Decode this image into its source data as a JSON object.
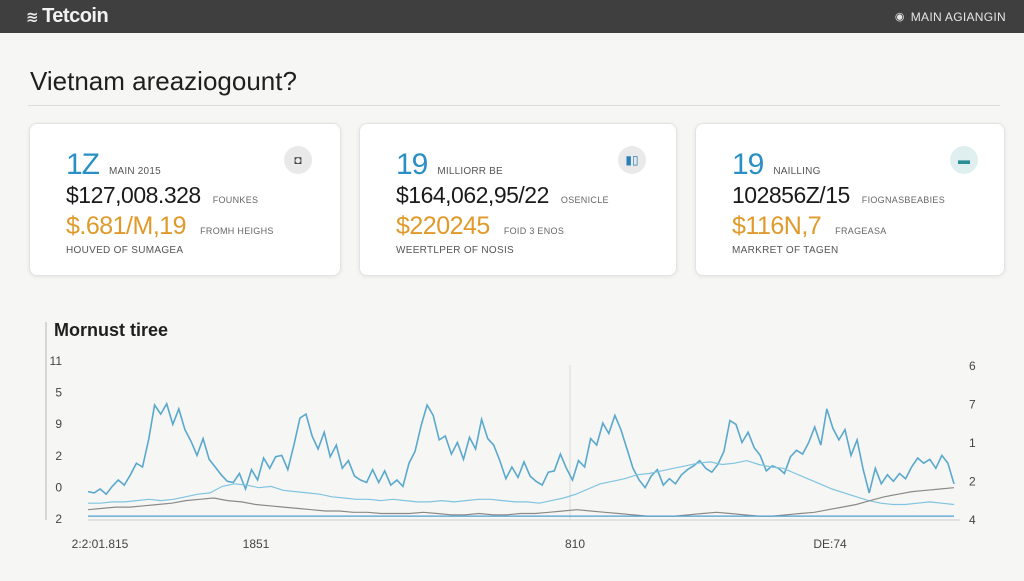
{
  "header": {
    "brand": "Tetcoin",
    "brand_icon": "stacked-coin-icon",
    "user_label": "MAIN AGIANGIN",
    "user_icon": "user-icon"
  },
  "page": {
    "title": "Vietnam areaziogount?"
  },
  "cards": [
    {
      "big_number": "1Z",
      "big_label": "MAIN 2015",
      "amount": "$127,008.328",
      "amount_label": "FOUNKES",
      "highlight": "$.681/M,19",
      "highlight_label": "FROMH HEIGHS",
      "footer": "HOUVED OF SUMAGEA",
      "icon": "wallet-icon"
    },
    {
      "big_number": "19",
      "big_label": "MILLIORR BE",
      "amount": "$164,062,95/22",
      "amount_label": "OSENICLE",
      "highlight": "$220245",
      "highlight_label": "FOID 3 ENOS",
      "footer": "WEERTLPER OF NOSIS",
      "icon": "bar-chart-icon"
    },
    {
      "big_number": "19",
      "big_label": "NAILLING",
      "amount": "102856Z/15",
      "amount_label": "FIOGNASBEABIES",
      "highlight": "$116N,7",
      "highlight_label": "FRAGEASA",
      "footer": "MARKRET OF TAGEN",
      "icon": "card-icon"
    }
  ],
  "chart_data": {
    "type": "line",
    "title": "Mornust tiree",
    "x_tick_labels": [
      "2:2:01.815",
      "1851",
      "810",
      "DE:74"
    ],
    "y_left_ticks": [
      "11",
      "5",
      "9",
      "2",
      "0",
      "2"
    ],
    "y_right_ticks": [
      "6",
      "7",
      "1",
      "2",
      "4"
    ],
    "ylim": [
      0,
      12
    ],
    "series": [
      {
        "color": "#5aa8cc",
        "values": [
          2.2,
          2.1,
          2.4,
          2.0,
          2.6,
          3.1,
          2.7,
          3.5,
          4.4,
          4.1,
          6.2,
          8.9,
          8.2,
          9.0,
          7.4,
          8.6,
          7.0,
          6.1,
          5.0,
          6.3,
          4.7,
          4.1,
          3.5,
          3.0,
          2.9,
          3.6,
          2.4,
          3.9,
          3.1,
          4.8,
          4.0,
          4.9,
          5.0,
          3.9,
          5.8,
          7.9,
          8.2,
          6.5,
          5.5,
          6.8,
          4.9,
          5.8,
          4.0,
          4.6,
          3.4,
          3.1,
          2.9,
          3.9,
          2.9,
          3.8,
          2.7,
          3.1,
          2.6,
          4.4,
          5.3,
          7.3,
          8.9,
          8.1,
          6.2,
          6.5,
          5.1,
          6.0,
          4.7,
          6.4,
          5.5,
          7.8,
          6.3,
          5.8,
          4.6,
          3.2,
          4.1,
          3.3,
          4.5,
          3.4,
          3.0,
          2.7,
          3.7,
          3.8,
          5.1,
          4.0,
          3.1,
          4.6,
          4.1,
          6.3,
          5.8,
          7.5,
          6.7,
          8.1,
          7.0,
          5.5,
          4.0,
          3.1,
          2.5,
          3.4,
          3.9,
          2.7,
          3.2,
          2.8,
          3.5,
          3.9,
          4.2,
          4.6,
          4.0,
          3.7,
          4.3,
          5.3,
          7.7,
          7.4,
          6.0,
          6.8,
          5.6,
          5.0,
          3.8,
          4.2,
          4.0,
          3.6,
          4.9,
          5.4,
          5.1,
          6.0,
          7.2,
          5.8,
          8.6,
          7.1,
          6.2,
          7.0,
          5.0,
          6.2,
          3.9,
          2.1,
          4.0,
          2.8,
          3.5,
          3.0,
          3.6,
          3.2,
          4.1,
          4.8,
          4.4,
          4.7,
          4.0,
          5.0,
          4.4,
          2.8
        ]
      },
      {
        "color": "#7fc4e0",
        "values": [
          1.3,
          1.3,
          1.4,
          1.4,
          1.5,
          1.6,
          1.5,
          1.6,
          1.8,
          2.0,
          2.1,
          2.6,
          2.8,
          2.7,
          2.5,
          2.6,
          2.3,
          2.2,
          2.1,
          2.0,
          1.8,
          1.7,
          1.6,
          1.6,
          1.5,
          1.6,
          1.5,
          1.4,
          1.4,
          1.5,
          1.4,
          1.5,
          1.6,
          1.6,
          1.5,
          1.4,
          1.4,
          1.3,
          1.5,
          1.7,
          2.0,
          2.4,
          2.8,
          3.0,
          3.2,
          3.5,
          3.6,
          3.8,
          4.0,
          4.2,
          4.4,
          4.5,
          4.3,
          4.4,
          4.6,
          4.3,
          4.1,
          4.0,
          3.6,
          3.2,
          2.8,
          2.4,
          2.1,
          1.8,
          1.5,
          1.3,
          1.2,
          1.2,
          1.3,
          1.4,
          1.3,
          1.2
        ]
      },
      {
        "color": "#8a8a8a",
        "values": [
          0.8,
          0.9,
          1.0,
          1.0,
          1.1,
          1.2,
          1.3,
          1.5,
          1.6,
          1.7,
          1.5,
          1.4,
          1.2,
          1.1,
          1.0,
          0.9,
          0.8,
          0.7,
          0.7,
          0.6,
          0.6,
          0.5,
          0.5,
          0.5,
          0.6,
          0.5,
          0.4,
          0.4,
          0.5,
          0.4,
          0.4,
          0.5,
          0.5,
          0.6,
          0.7,
          0.8,
          0.7,
          0.6,
          0.5,
          0.4,
          0.3,
          0.3,
          0.3,
          0.4,
          0.5,
          0.6,
          0.5,
          0.4,
          0.3,
          0.3,
          0.4,
          0.5,
          0.6,
          0.8,
          1.0,
          1.2,
          1.5,
          1.8,
          2.0,
          2.2,
          2.3,
          2.4,
          2.5
        ]
      },
      {
        "color": "#4d9fd1",
        "values": [
          0.3,
          0.3,
          0.3,
          0.3,
          0.3,
          0.3,
          0.3,
          0.3,
          0.3,
          0.3,
          0.3,
          0.3,
          0.3,
          0.3,
          0.3,
          0.3,
          0.3,
          0.3,
          0.3,
          0.3,
          0.3,
          0.3,
          0.3,
          0.3,
          0.3,
          0.3,
          0.3,
          0.3,
          0.3,
          0.3,
          0.3,
          0.3,
          0.3,
          0.3,
          0.3,
          0.3,
          0.3,
          0.3,
          0.3,
          0.3,
          0.3,
          0.3,
          0.3,
          0.3,
          0.3,
          0.3,
          0.3,
          0.3,
          0.3,
          0.3,
          0.3,
          0.3,
          0.3,
          0.3,
          0.3,
          0.3,
          0.3,
          0.3,
          0.3,
          0.3,
          0.3,
          0.3,
          0.3
        ]
      }
    ]
  }
}
